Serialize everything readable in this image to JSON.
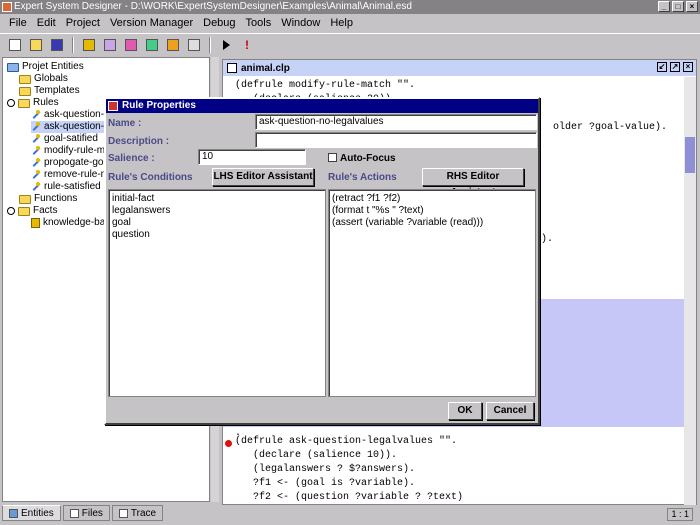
{
  "window": {
    "title": "Expert System Designer - D:\\WORK\\ExpertSystemDesigner\\Examples\\Animal\\Animal.esd"
  },
  "menu": [
    "File",
    "Edit",
    "Project",
    "Version Manager",
    "Debug",
    "Tools",
    "Window",
    "Help"
  ],
  "tree": {
    "root": "Projet Entities",
    "globals": "Globals",
    "templates": "Templates",
    "rules": "Rules",
    "rule_items": [
      "ask-question-le",
      "ask-question-no",
      "goal-satified",
      "modify-rule-ma",
      "propogate-goal",
      "remove-rule-no",
      "rule-satisfied"
    ],
    "functions": "Functions",
    "facts": "Facts",
    "fact_items": [
      "knowledge-bas"
    ]
  },
  "bottom_tabs": [
    "Entities",
    "Files",
    "Trace"
  ],
  "editor": {
    "tab_title": "animal.clp",
    "lines_top": [
      "(defrule modify-rule-match \"\".",
      "   (declare (salience 20)).",
      "older ?goal-value).",
      ")."
    ],
    "lines_bottom": [
      ".",
      "(defrule ask-question-legalvalues \"\".",
      "   (declare (salience 10)).",
      "   (legalanswers ? $?answers).",
      "   ?f1 <- (goal is ?variable).",
      "   ?f2 <- (question ?variable ? ?text)"
    ],
    "position": "1 : 1"
  },
  "dialog": {
    "title": "Rule Properties",
    "name_label": "Name :",
    "name_value": "ask-question-no-legalvalues",
    "description_label": "Description :",
    "description_value": "",
    "salience_label": "Salience :",
    "salience_value": "10",
    "autofocus_label": "Auto-Focus",
    "conditions_label": "Rule's Conditions",
    "actions_label": "Rule's Actions",
    "lhs_button": "LHS Editor Assistant",
    "rhs_button": "RHS Editor Assistant",
    "conditions": [
      "initial-fact",
      "legalanswers",
      "goal",
      "question"
    ],
    "actions": [
      "(retract ?f1 ?f2)",
      "(format t \"%s \" ?text)",
      "(assert (variable ?variable (read)))"
    ],
    "ok_button": "OK",
    "cancel_button": "Cancel"
  }
}
